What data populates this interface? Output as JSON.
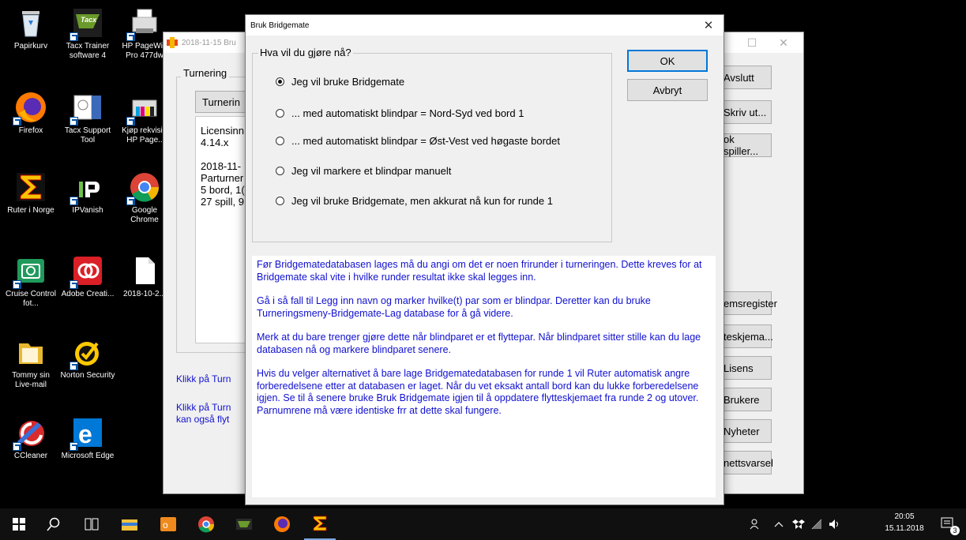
{
  "desktop": {
    "icons": [
      {
        "label": "Papirkurv",
        "icon": "recycle-bin-icon"
      },
      {
        "label": "Tacx Trainer software 4",
        "icon": "tacx-icon"
      },
      {
        "label": "HP PageWid Pro 477dw",
        "icon": "printer-icon"
      },
      {
        "label": "Firefox",
        "icon": "firefox-icon"
      },
      {
        "label": "Tacx Support Tool",
        "icon": "tacx-support-icon"
      },
      {
        "label": "Kjøp rekvisi - HP Page..",
        "icon": "hp-supplies-icon"
      },
      {
        "label": "Ruter i Norge",
        "icon": "ruter-icon"
      },
      {
        "label": "IPVanish",
        "icon": "ipvanish-icon"
      },
      {
        "label": "Google Chrome",
        "icon": "chrome-icon"
      },
      {
        "label": "Cruise Control fot...",
        "icon": "camera-icon"
      },
      {
        "label": "Adobe Creati...",
        "icon": "adobe-cc-icon"
      },
      {
        "label": "2018-10-2...",
        "icon": "document-icon"
      },
      {
        "label": "Tommy sin Live-mail",
        "icon": "folder-icon"
      },
      {
        "label": "Norton Security",
        "icon": "norton-icon"
      },
      {
        "label": "CCleaner",
        "icon": "ccleaner-icon"
      },
      {
        "label": "Microsoft Edge",
        "icon": "edge-icon"
      }
    ]
  },
  "background_window": {
    "title": "2018-11-15 Bru",
    "group_label": "Turnering",
    "turnering_button": "Turnerin",
    "info_lines": [
      "Licensinn",
      "4.14.x",
      "",
      "2018-11-",
      "Parturner",
      "5 bord, 1(",
      "27 spill, 9"
    ],
    "right_buttons": [
      "Avslutt",
      "Skriv ut...",
      "ok spiller...",
      "emsregister",
      "teskjema...",
      "Lisens",
      "Brukere",
      "Nyheter",
      "nettsvarsel"
    ],
    "blue_text_1": "Klikk på Turn",
    "blue_text_2": "Klikk på Turn",
    "blue_text_3": "kan også flyt"
  },
  "dialog": {
    "title": "Bruk Bridgemate",
    "group_label": "Hva vil du gjøre nå?",
    "options": [
      {
        "label": "Jeg vil bruke Bridgemate",
        "selected": true
      },
      {
        "label": "... med automatiskt blindpar = Nord-Syd ved bord 1",
        "selected": false
      },
      {
        "label": "... med automatiskt blindpar = Øst-Vest ved høgaste bordet",
        "selected": false
      },
      {
        "label": "Jeg vil markere et blindpar manuelt",
        "selected": false
      },
      {
        "label": "Jeg vil bruke Bridgemate, men akkurat nå kun for runde 1",
        "selected": false
      }
    ],
    "ok_label": "OK",
    "cancel_label": "Avbryt",
    "info": [
      "Før Bridgematedatabasen lages må du angi om det er noen frirunder i turneringen. Dette kreves for at Bridgemate skal vite i hvilke runder resultat ikke skal legges inn.",
      "Gå i så fall til Legg inn navn og marker hvilke(t) par som er blindpar. Deretter kan du bruke Turneringsmeny-Bridgemate-Lag database for å gå videre.",
      "Merk at du bare trenger gjøre dette når blindparet er et flyttepar. Når blindparet sitter stille kan du lage databasen nå og markere blindparet senere.",
      "Hvis du velger alternativet å bare lage Bridgematedatabasen for runde 1 vil Ruter automatisk angre forberedelsene etter at databasen er laget. Når du vet eksakt antall bord kan du lukke forberedelsene igjen. Se til å senere bruke Bruk Bridgemate igjen til å oppdatere flytteskjemaet fra runde 2 og utover. Parnumrene må være identiske frr at dette skal fungere."
    ]
  },
  "taskbar": {
    "time": "20:05",
    "date": "15.11.2018",
    "notification_count": "3"
  }
}
